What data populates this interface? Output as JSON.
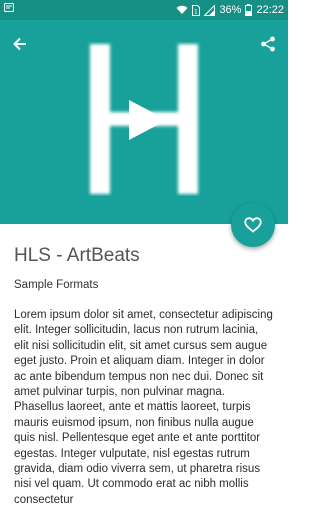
{
  "status_bar": {
    "battery_percent": "36%",
    "time": "22:22",
    "icons": [
      "notification-icon",
      "wifi-icon",
      "sim-icon",
      "signal-icon",
      "battery-icon"
    ]
  },
  "toolbar": {
    "back_icon": "arrow-back-icon",
    "share_icon": "share-icon"
  },
  "hero": {
    "thumbnail_letter": "H",
    "play_icon": "play-icon",
    "background": "#17a19a"
  },
  "fab": {
    "icon": "heart-outline-icon",
    "color": "#17a19a"
  },
  "content": {
    "title": "HLS - ArtBeats",
    "subtitle": "Sample Formats",
    "description": "Lorem ipsum dolor sit amet, consectetur adipiscing elit. Integer sollicitudin, lacus non rutrum lacinia, elit nisi sollicitudin elit, sit amet cursus sem augue eget justo. Proin et aliquam diam. Integer in dolor ac ante bibendum tempus non nec dui. Donec sit amet pulvinar turpis, non pulvinar magna. Phasellus laoreet, ante et mattis laoreet, turpis mauris euismod ipsum, non finibus nulla augue quis nisl. Pellentesque eget ante et ante porttitor egestas. Integer vulputate, nisl egestas rutrum gravida, diam odio viverra sem, ut pharetra risus nisi vel quam. Ut commodo erat ac nibh mollis consectetur"
  }
}
